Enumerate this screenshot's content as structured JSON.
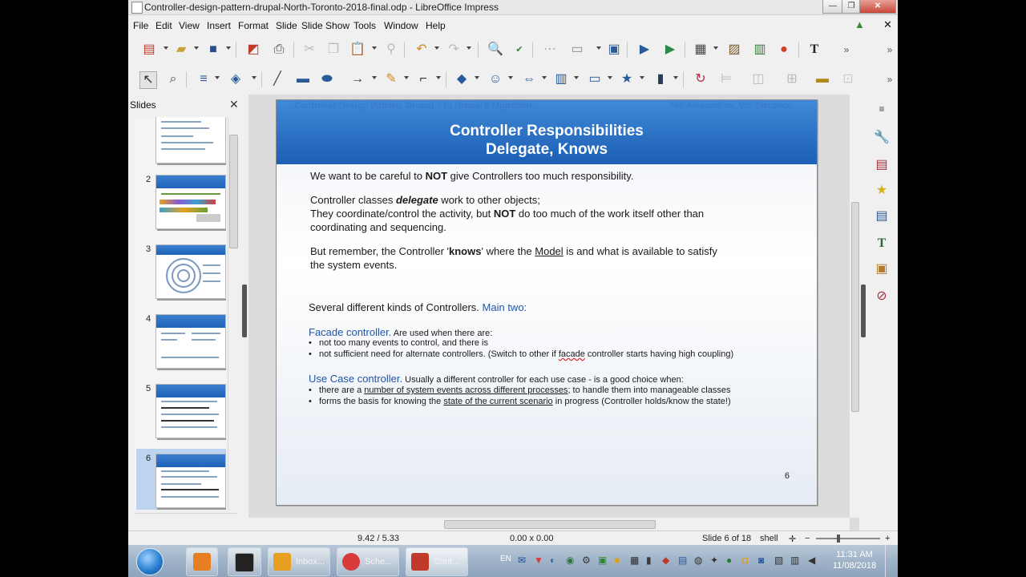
{
  "window": {
    "title": "Controller-design-pattern-drupal-North-Toronto-2018-final.odp - LibreOffice Impress",
    "minimize": "—",
    "maximize": "❐",
    "close": "✕"
  },
  "menubar": {
    "items": [
      "File",
      "Edit",
      "View",
      "Insert",
      "Format",
      "Slide",
      "Slide Show",
      "Tools",
      "Window",
      "Help"
    ],
    "close_doc": "✕"
  },
  "slides_pane": {
    "title": "Slides",
    "close": "✕",
    "thumbs": [
      {
        "num": ""
      },
      {
        "num": "2"
      },
      {
        "num": "3"
      },
      {
        "num": "4"
      },
      {
        "num": "5"
      },
      {
        "num": "6"
      }
    ]
  },
  "slide": {
    "header_left": "Controller Design Pattern. Drupal 7 to Drupal 8 Migration.",
    "header_right": "Nik Alexandrov, Vic Tarcenco",
    "title1": "Controller Responsibilities",
    "title2": "Delegate, Knows",
    "p1_a": "We want to be careful to ",
    "p1_b": "NOT",
    "p1_c": " give Controllers too much responsibility.",
    "p2_a": "Controller classes ",
    "p2_b": "delegate",
    "p2_c": " work to other objects;",
    "p3_a": "They coordinate/control the activity, but ",
    "p3_b": "NOT",
    "p3_c": " do too much of the work itself other than",
    "p4": "coordinating and sequencing.",
    "p5_a": "But remember, the Controller '",
    "p5_b": "knows",
    "p5_c": "' where the ",
    "p5_d": "Model",
    "p5_e": " is and what is available to satisfy",
    "p6": "the system events.",
    "p7_a": "Several different kinds of Controllers. ",
    "p7_b": "Main two:",
    "facade_title": "Facade controller.",
    "facade_desc": " Are used when there are:",
    "facade_b1": "not too many events to control, and there is",
    "facade_b2_a": "not sufficient need for alternate controllers. (Switch to other if ",
    "facade_b2_b": "facade",
    "facade_b2_c": " controller starts having high coupling)",
    "usecase_title": "Use Case controller.",
    "usecase_desc": " Usually a different controller for each use case - is a good choice when:",
    "usecase_b1_a": "there are a ",
    "usecase_b1_b": "number of system events across different processes",
    "usecase_b1_c": "; to handle them into manageable classes",
    "usecase_b2_a": "forms the basis for knowing the ",
    "usecase_b2_b": "state of the current scenario",
    "usecase_b2_c": " in progress (Controller holds/know the state!)",
    "number": "6",
    "bullet": "•"
  },
  "statusbar": {
    "position": "9.42 / 5.33",
    "size": "0.00 x 0.00",
    "slide": "Slide 6 of 18",
    "master": "shell",
    "zoom_plus": "+",
    "zoom_minus": "−"
  },
  "taskbar": {
    "tasks": [
      {
        "label": "Inbox..."
      },
      {
        "label": "Sche..."
      },
      {
        "label": "Cont..."
      }
    ],
    "lang": "EN",
    "time": "11:31 AM",
    "date": "11/08/2018"
  },
  "colors": {
    "accent_blue": "#1f55a5",
    "slide_header": "#2a6fc2"
  }
}
